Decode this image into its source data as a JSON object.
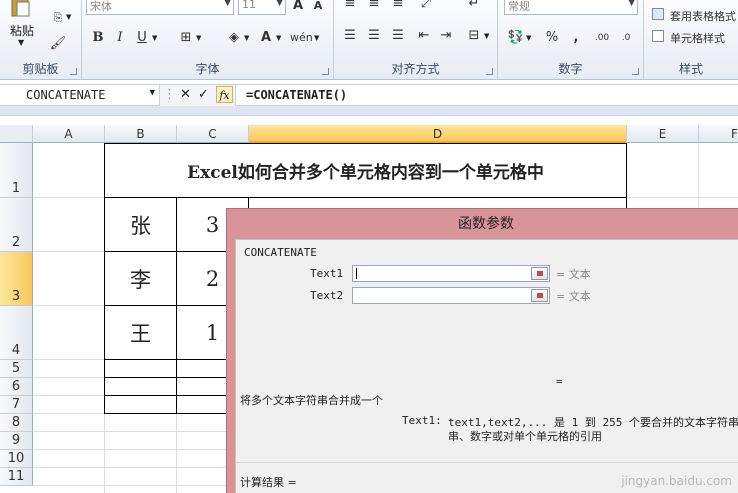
{
  "ribbon": {
    "paste_label": "粘贴",
    "clipboard_group": "剪贴板",
    "font_name": "宋体",
    "font_size": "11",
    "font_group": "字体",
    "bold": "B",
    "italic": "I",
    "underline": "U",
    "align_group": "对齐方式",
    "number_format": "常规",
    "number_group": "数字",
    "percent": "%",
    "comma": ",",
    "table_format": "套用表格格式",
    "cell_style": "单元格样式",
    "style_group": "样式"
  },
  "formula_bar": {
    "name_box": "CONCATENATE",
    "fx": "fx",
    "formula": "=CONCATENATE()"
  },
  "grid": {
    "columns": [
      "A",
      "B",
      "C",
      "D",
      "E",
      "F"
    ],
    "selected_column": "D",
    "rows": [
      "1",
      "2",
      "3",
      "4",
      "5",
      "6",
      "7",
      "8",
      "9",
      "10",
      "11"
    ],
    "selected_row": "3",
    "title": "Excel如何合并多个单元格内容到一个单元格中",
    "data_rows": [
      {
        "b": "张",
        "c": "3"
      },
      {
        "b": "李",
        "c": "2"
      },
      {
        "b": "王",
        "c": "1"
      }
    ]
  },
  "dialog": {
    "title": "函数参数",
    "function_name": "CONCATENATE",
    "args": [
      {
        "label": "Text1",
        "result": "= 文本"
      },
      {
        "label": "Text2",
        "result": "= 文本"
      }
    ],
    "result_eq": "=",
    "description": "将多个文本字符串合并成一个",
    "arg_help_label": "Text1:",
    "arg_help_line1": "text1,text2,... 是 1 到 255 个要合并的文本字符串",
    "arg_help_line2": "串、数字或对单个单元格的引用",
    "calc_result": "计算结果 ="
  },
  "watermark": "jingyan.baidu.com"
}
